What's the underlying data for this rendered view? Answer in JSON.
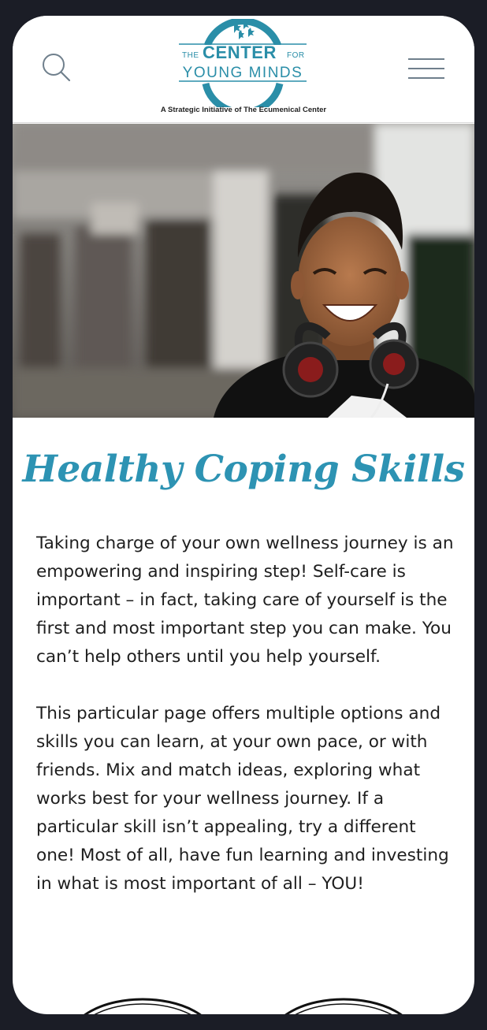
{
  "header": {
    "logo": {
      "the": "THE",
      "center": "CENTER",
      "for": "FOR",
      "young_minds": "YOUNG MINDS"
    },
    "tagline": "A Strategic Initiative of The Ecumenical Center",
    "search_icon": "search-icon",
    "menu_icon": "hamburger-menu-icon"
  },
  "hero": {
    "image": "smiling teen with headphones"
  },
  "main": {
    "title": "Healthy Coping Skills",
    "paragraph_1": "Taking charge of your own wellness journey is an empowering and inspiring step! Self-care is important – in fact, taking care of yourself is the first and most important step you can make. You can’t help others until you help yourself.",
    "paragraph_2": "This particular page offers multiple options and skills you can learn, at your own pace, or with friends. Mix and match ideas, exploring what works best for your wellness journey. If a particular skill isn’t appealing, try a different one! Most of all, have fun learning and investing in what is most important of all – YOU!"
  },
  "colors": {
    "brand": "#2a8ea8",
    "title": "#2d93b3",
    "frame": "#1b1d26"
  }
}
